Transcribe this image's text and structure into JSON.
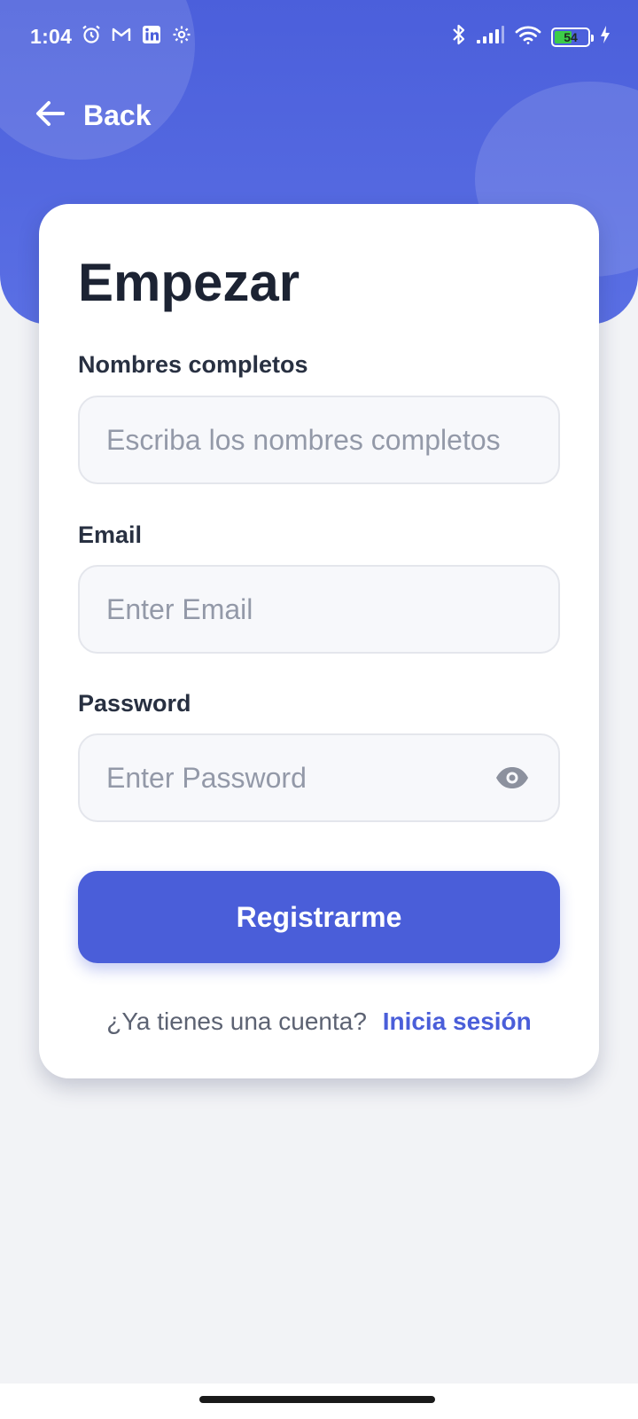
{
  "status_bar": {
    "time": "1:04",
    "left_icons": [
      "alarm-icon",
      "gmail-icon",
      "linkedin-icon",
      "settings-icon"
    ],
    "right_icons": [
      "bluetooth-icon",
      "signal-icon",
      "wifi-icon",
      "battery-icon",
      "charging-icon"
    ],
    "battery_level": "54",
    "battery_fraction": 0.54
  },
  "header": {
    "back_label": "Back",
    "back_icon": "arrow-left-icon"
  },
  "form": {
    "title": "Empezar",
    "fields": [
      {
        "label": "Nombres completos",
        "placeholder": "Escriba los nombres completos",
        "value": ""
      },
      {
        "label": "Email",
        "placeholder": "Enter Email",
        "value": ""
      },
      {
        "label": "Password",
        "placeholder": "Enter Password",
        "value": "",
        "icon": "eye-icon"
      }
    ],
    "submit_label": "Registrarme",
    "login_prompt": "¿Ya tienes una cuenta?",
    "login_link": "Inicia sesión"
  },
  "colors": {
    "primary": "#4a5ed9",
    "header": "#4b5fdb",
    "background": "#f2f3f6",
    "title": "#1c2333",
    "battery": "#3ccd49"
  }
}
